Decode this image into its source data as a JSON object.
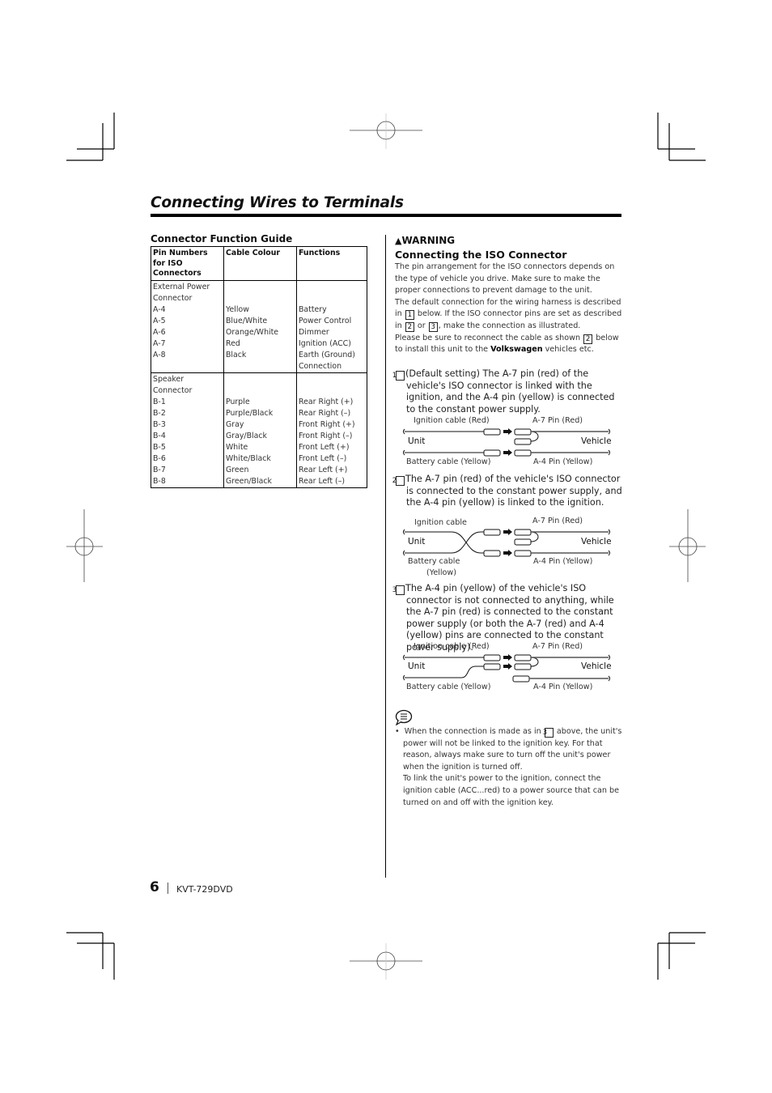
{
  "page": {
    "title": "Connecting Wires to Terminals",
    "page_number": "6",
    "model": "KVT-729DVD"
  },
  "guide": {
    "heading": "Connector Function Guide",
    "columns": [
      "Pin Numbers for ISO Connectors",
      "Cable Colour",
      "Functions"
    ],
    "groups": [
      {
        "name": "External Power Connector",
        "rows": [
          {
            "pin": "A-4",
            "colour": "Yellow",
            "function": "Battery"
          },
          {
            "pin": "A-5",
            "colour": "Blue/White",
            "function": "Power Control"
          },
          {
            "pin": "A-6",
            "colour": "Orange/White",
            "function": "Dimmer"
          },
          {
            "pin": "A-7",
            "colour": "Red",
            "function": "Ignition (ACC)"
          },
          {
            "pin": "A-8",
            "colour": "Black",
            "function": "Earth (Ground) Connection"
          }
        ]
      },
      {
        "name": "Speaker Connector",
        "rows": [
          {
            "pin": "B-1",
            "colour": "Purple",
            "function": "Rear Right (+)"
          },
          {
            "pin": "B-2",
            "colour": "Purple/Black",
            "function": "Rear Right (–)"
          },
          {
            "pin": "B-3",
            "colour": "Gray",
            "function": "Front Right (+)"
          },
          {
            "pin": "B-4",
            "colour": "Gray/Black",
            "function": "Front Right (–)"
          },
          {
            "pin": "B-5",
            "colour": "White",
            "function": "Front Left (+)"
          },
          {
            "pin": "B-6",
            "colour": "White/Black",
            "function": "Front Left (–)"
          },
          {
            "pin": "B-7",
            "colour": "Green",
            "function": "Rear Left (+)"
          },
          {
            "pin": "B-8",
            "colour": "Green/Black",
            "function": "Rear Left (–)"
          }
        ]
      }
    ]
  },
  "warning": {
    "label": "WARNING",
    "heading": "Connecting the ISO Connector",
    "p1": "The pin arrangement for the ISO connectors depends on the type of vehicle you drive. Make sure to make the proper connections to prevent damage to the unit.",
    "p2a": "The default connection for the wiring harness is described in",
    "p2b": "below. If the ISO connector pins are set as described in",
    "p2c": "or",
    "p2d": ", make the connection as illustrated.",
    "p3a": "Please be sure to reconnect the cable as shown",
    "p3b": "below to install this unit to the",
    "p3bold": "Volkswagen",
    "p3c": "vehicles etc."
  },
  "steps": [
    {
      "num": "1",
      "text": "(Default setting) The A-7 pin (red) of the vehicle's ISO connector is linked with the ignition, and the A-4 pin (yellow) is connected to the constant power supply.",
      "top_left": "Ignition cable (Red)",
      "top_right": "A-7 Pin (Red)",
      "unit": "Unit",
      "vehicle": "Vehicle",
      "bottom_left": "Battery cable (Yellow)",
      "bottom_right": "A-4 Pin (Yellow)"
    },
    {
      "num": "2",
      "text": "The A-7 pin (red) of the vehicle's ISO connector is connected to the constant power supply, and the A-4 pin (yellow) is linked to the ignition.",
      "top_left": "Ignition cable",
      "top_right": "A-7 Pin (Red)",
      "unit": "Unit",
      "vehicle": "Vehicle",
      "bottom_left": "Battery cable",
      "bottom_left2": "(Yellow)",
      "bottom_right": "A-4 Pin (Yellow)"
    },
    {
      "num": "3",
      "text": "The A-4 pin (yellow) of the vehicle's ISO connector is not connected to anything, while the A-7 pin (red) is connected to the constant power supply (or both the A-7 (red) and A-4 (yellow) pins are connected to the constant power supply).",
      "top_left": "Ignition cable (Red)",
      "top_right": "A-7 Pin (Red)",
      "unit": "Unit",
      "vehicle": "Vehicle",
      "bottom_left": "Battery cable (Yellow)",
      "bottom_right": "A-4 Pin (Yellow)"
    }
  ],
  "note": {
    "icon": "note-icon",
    "b1a": "When the connection is made as in",
    "b1num": "3",
    "b1b": "above, the unit's power will not be linked to the ignition key. For that reason, always make sure to turn off the unit's power when the ignition is turned off.",
    "b2": "To link the unit's power to the ignition, connect the ignition cable (ACC...red) to a power source that can be turned on and off with the ignition key."
  }
}
